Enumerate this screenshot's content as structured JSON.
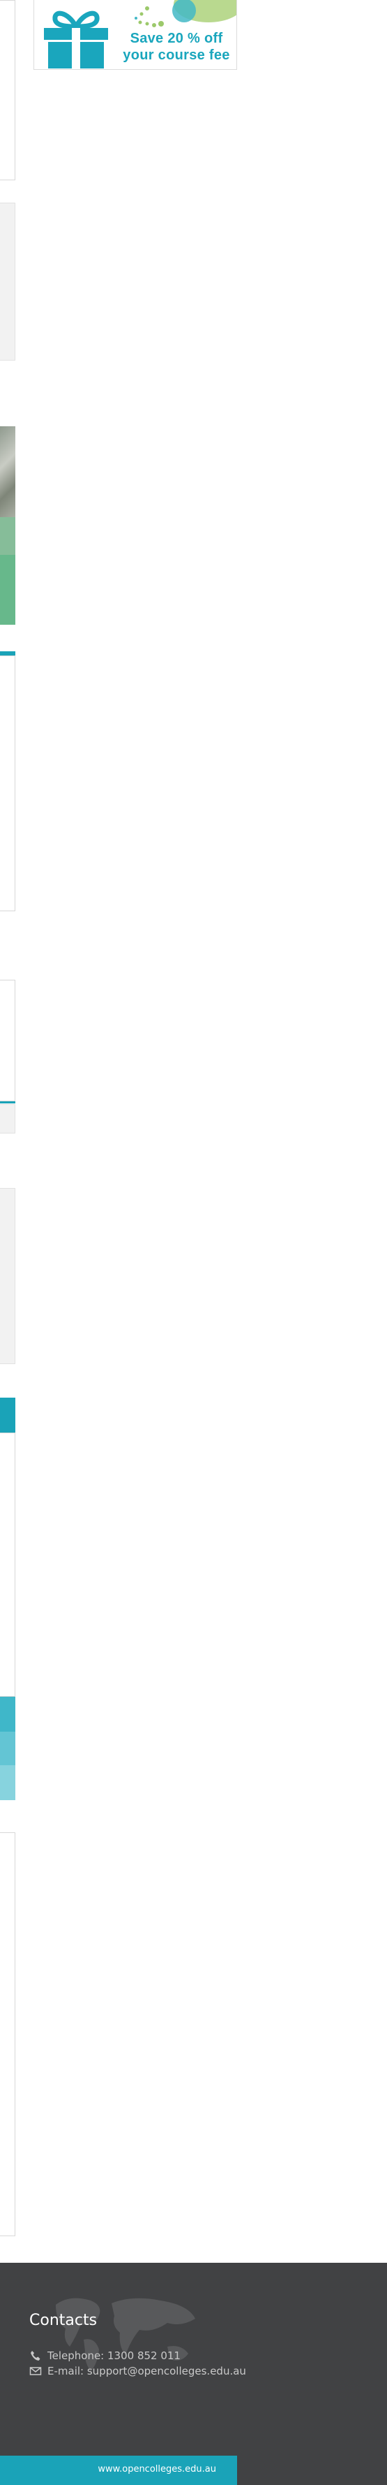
{
  "promo": {
    "line1": "Save 20 % off",
    "line2": "your course fee",
    "icon": "gift-icon",
    "accent_color": "#1aa6bd",
    "secondary_color": "#b9d98f"
  },
  "footer": {
    "title": "Contacts",
    "phone_text": "Telephone: 1300  852 011",
    "email_text": "E-mail: support@opencolleges.edu.au",
    "website": "www.opencolleges.edu.au",
    "background_color": "#414244",
    "bar_color": "#1aa3b8"
  }
}
